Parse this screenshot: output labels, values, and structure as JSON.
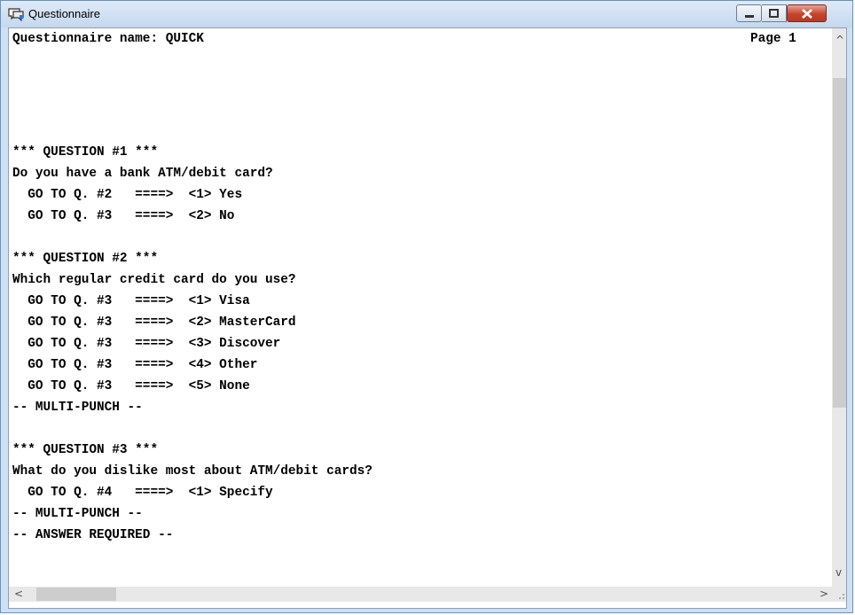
{
  "window": {
    "title": "Questionnaire",
    "icons": {
      "app": "questionnaire-app-icon",
      "minimize": "minimize-icon",
      "maximize": "maximize-icon",
      "close": "close-icon"
    },
    "colors": {
      "title_bar": "#c4d8ee",
      "close_button": "#c7442c"
    }
  },
  "header": {
    "questionnaire_name": "Questionnaire name: QUICK",
    "page": "Page 1"
  },
  "questions": [
    {
      "title": "*** QUESTION #1 ***",
      "text": "Do you have a bank ATM/debit card?",
      "answers": [
        {
          "text": "  GO TO Q. #2   ====>  <1> Yes"
        },
        {
          "text": "  GO TO Q. #3   ====>  <2> No"
        }
      ],
      "flags": []
    },
    {
      "title": "*** QUESTION #2 ***",
      "text": "Which regular credit card do you use?",
      "answers": [
        {
          "text": "  GO TO Q. #3   ====>  <1> Visa"
        },
        {
          "text": "  GO TO Q. #3   ====>  <2> MasterCard"
        },
        {
          "text": "  GO TO Q. #3   ====>  <3> Discover"
        },
        {
          "text": "  GO TO Q. #3   ====>  <4> Other"
        },
        {
          "text": "  GO TO Q. #3   ====>  <5> None"
        }
      ],
      "flags": [
        "-- MULTI-PUNCH --"
      ]
    },
    {
      "title": "*** QUESTION #3 ***",
      "text": "What do you dislike most about ATM/debit cards?",
      "answers": [
        {
          "text": "  GO TO Q. #4   ====>  <1> Specify"
        }
      ],
      "flags": [
        "-- MULTI-PUNCH --",
        "-- ANSWER REQUIRED --"
      ]
    }
  ],
  "scrollbars": {
    "up_arrow": "^",
    "down_arrow": "v",
    "left_arrow": "<",
    "right_arrow": ">"
  }
}
